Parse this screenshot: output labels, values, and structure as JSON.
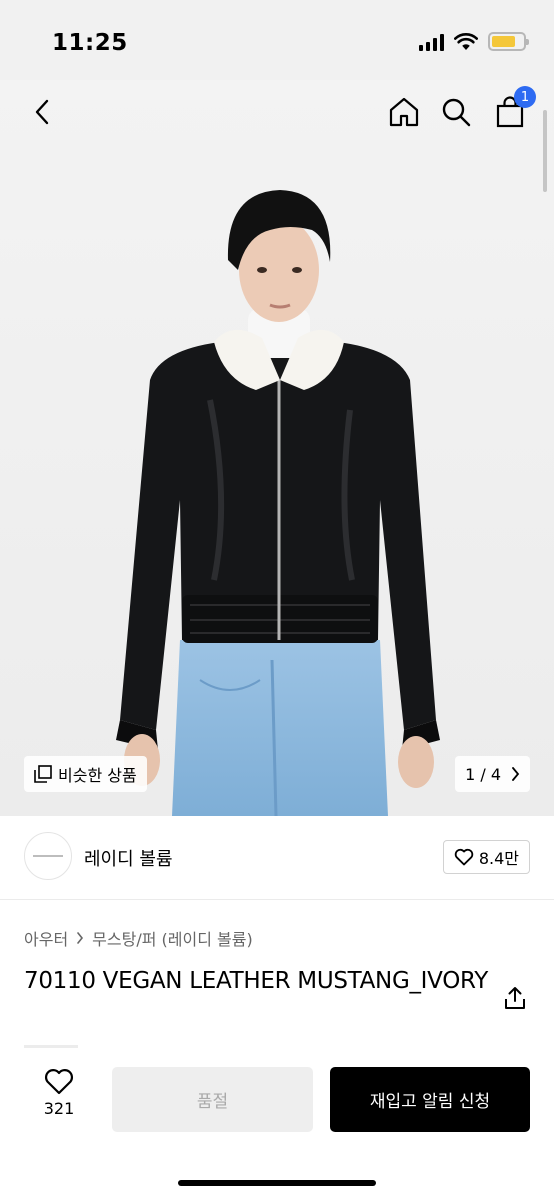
{
  "status_bar": {
    "time": "11:25",
    "battery_color": "#f4c73a"
  },
  "nav": {
    "cart_count": "1",
    "badge_color": "#2e6bf2"
  },
  "gallery": {
    "similar_label": "비슷한 상품",
    "page_indicator": "1 / 4",
    "current_image": 1,
    "total_images": 4
  },
  "brand": {
    "name": "레이디 볼륨",
    "like_count": "8.4만"
  },
  "breadcrumb": {
    "category": "아우터",
    "subcategory": "무스탕/퍼 (레이디 볼륨)"
  },
  "product": {
    "title": "70110 VEGAN LEATHER MUSTANG_IVORY"
  },
  "bottom_bar": {
    "wish_count": "321",
    "soldout_label": "품절",
    "restock_label": "재입고 알림 신청"
  }
}
